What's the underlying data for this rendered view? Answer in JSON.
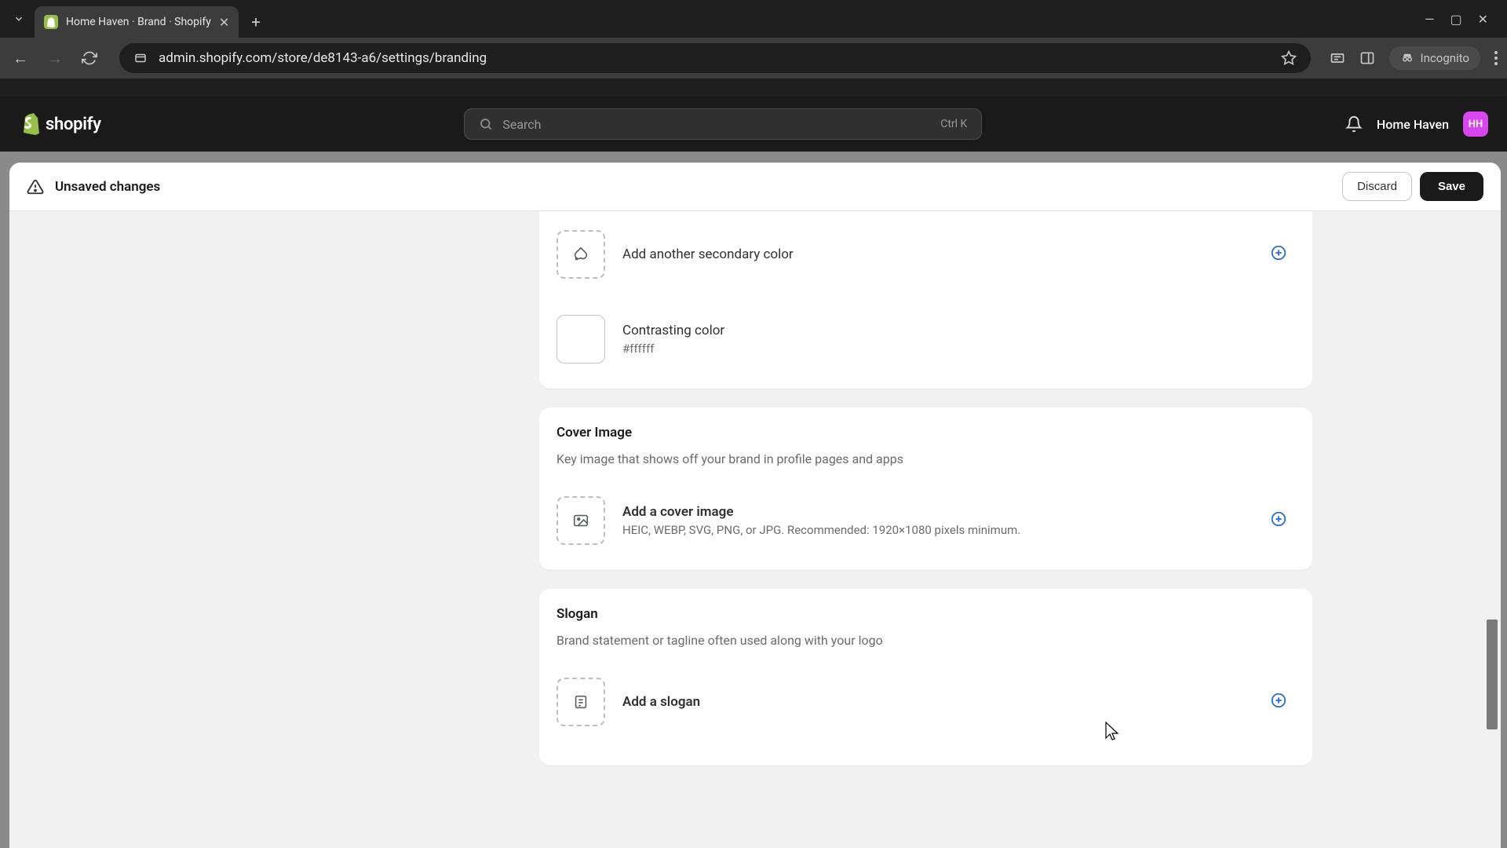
{
  "browser": {
    "tab_title": "Home Haven · Brand · Shopify",
    "url": "admin.shopify.com/store/de8143-a6/settings/branding",
    "incognito_label": "Incognito"
  },
  "shopify_header": {
    "logo_text": "shopify",
    "search_placeholder": "Search",
    "search_shortcut": "Ctrl K",
    "store_name": "Home Haven",
    "store_initials": "HH"
  },
  "unsaved_bar": {
    "message": "Unsaved changes",
    "discard_label": "Discard",
    "save_label": "Save"
  },
  "sections": {
    "colors": {
      "secondary_add_label": "Add another secondary color",
      "contrasting_label": "Contrasting color",
      "contrasting_value": "#ffffff"
    },
    "cover_image": {
      "title": "Cover Image",
      "description": "Key image that shows off your brand in profile pages and apps",
      "add_label": "Add a cover image",
      "add_hint": "HEIC, WEBP, SVG, PNG, or JPG. Recommended: 1920×1080 pixels minimum."
    },
    "slogan": {
      "title": "Slogan",
      "description": "Brand statement or tagline often used along with your logo",
      "add_label": "Add a slogan"
    }
  }
}
